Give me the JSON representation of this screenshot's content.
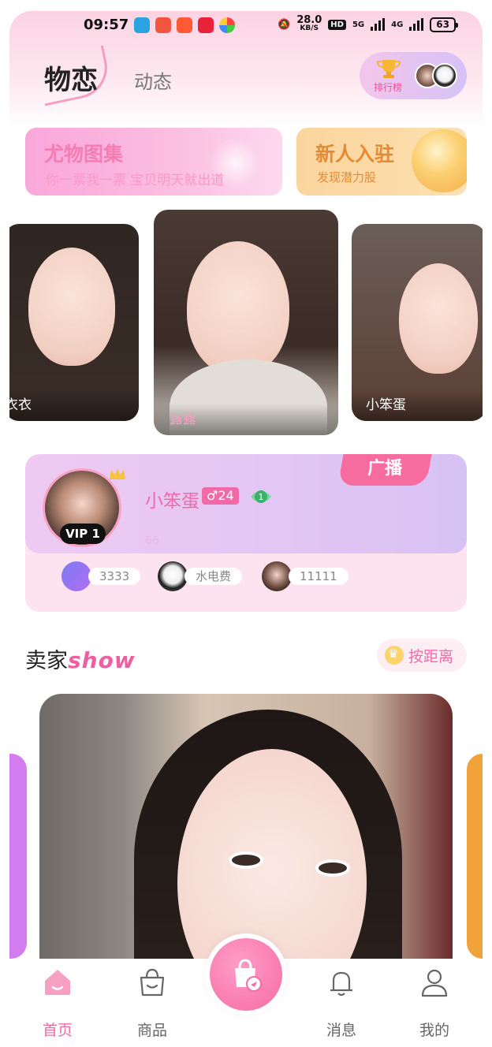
{
  "status_bar": {
    "time": "09:57",
    "speed_value": "28.0",
    "speed_unit": "KB/S",
    "hd": "HD",
    "net1": "5G",
    "net2": "4G",
    "battery": "63"
  },
  "header": {
    "tab_active": "物恋",
    "tab_2": "动态",
    "rank_label": "排行榜"
  },
  "banners": [
    {
      "title": "尤物图集",
      "subtitle": "你一票我一票 宝贝明天就出道"
    },
    {
      "title": "新人入驻",
      "subtitle": "发现潜力股"
    }
  ],
  "carousel": [
    {
      "name": "衣衣"
    },
    {
      "name": "露露"
    },
    {
      "name": "小笨蛋"
    }
  ],
  "broadcast": {
    "tag": "广播",
    "vip": "VIP 1",
    "name": "小笨蛋",
    "gender_age": "♂24",
    "level": "1",
    "message": "66",
    "chips": [
      {
        "label": "3333"
      },
      {
        "label": "水电费"
      },
      {
        "label": "11111"
      }
    ]
  },
  "seller_section": {
    "title": "卖家",
    "title_accent": "show",
    "sort_label": "按距离"
  },
  "nav": {
    "home": "首页",
    "goods": "商品",
    "messages": "消息",
    "mine": "我的"
  },
  "colors": {
    "accent_pink": "#f06aa8",
    "banner_pink": "#f9a7da",
    "banner_orange": "#fbd59e"
  }
}
